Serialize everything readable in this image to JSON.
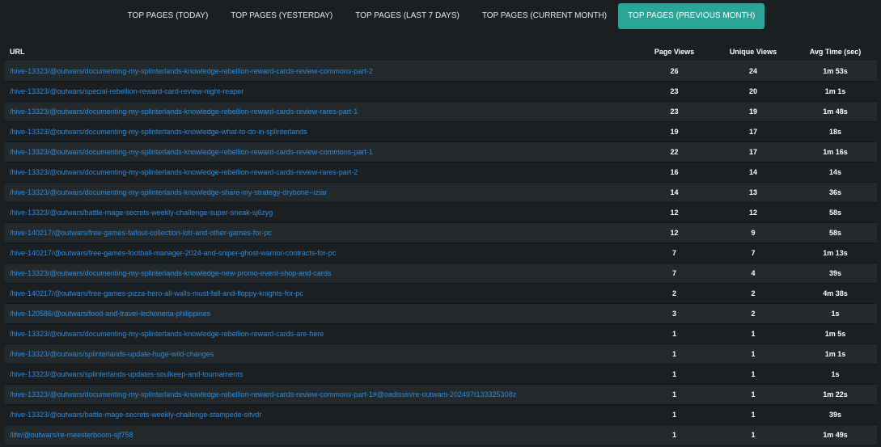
{
  "tabs": [
    {
      "label": "TOP PAGES (TODAY)",
      "active": false
    },
    {
      "label": "TOP PAGES (YESTERDAY)",
      "active": false
    },
    {
      "label": "TOP PAGES (LAST 7 DAYS)",
      "active": false
    },
    {
      "label": "TOP PAGES (CURRENT MONTH)",
      "active": false
    },
    {
      "label": "TOP PAGES (PREVIOUS MONTH)",
      "active": true
    }
  ],
  "table": {
    "headers": {
      "url": "URL",
      "page_views": "Page Views",
      "unique_views": "Unique Views",
      "avg_time": "Avg Time (sec)"
    },
    "rows": [
      {
        "url": "/hive-13323/@outwars/documenting-my-splinterlands-knowledge-rebellion-reward-cards-review-commons-part-2",
        "page_views": "26",
        "unique_views": "24",
        "avg_time": "1m 53s"
      },
      {
        "url": "/hive-13323/@outwars/special-rebellion-reward-card-review-night-reaper",
        "page_views": "23",
        "unique_views": "20",
        "avg_time": "1m 1s"
      },
      {
        "url": "/hive-13323/@outwars/documenting-my-splinterlands-knowledge-rebellion-reward-cards-review-rares-part-1",
        "page_views": "23",
        "unique_views": "19",
        "avg_time": "1m 48s"
      },
      {
        "url": "/hive-13323/@outwars/documenting-my-splinterlands-knowledge-what-to-do-in-splinterlands",
        "page_views": "19",
        "unique_views": "17",
        "avg_time": "18s"
      },
      {
        "url": "/hive-13323/@outwars/documenting-my-splinterlands-knowledge-rebellion-reward-cards-review-commons-part-1",
        "page_views": "22",
        "unique_views": "17",
        "avg_time": "1m 16s"
      },
      {
        "url": "/hive-13323/@outwars/documenting-my-splinterlands-knowledge-rebellion-reward-cards-review-rares-part-2",
        "page_views": "16",
        "unique_views": "14",
        "avg_time": "14s"
      },
      {
        "url": "/hive-13323/@outwars/documenting-my-splinterlands-knowledge-share-my-strategy-drybone--iziar",
        "page_views": "14",
        "unique_views": "13",
        "avg_time": "36s"
      },
      {
        "url": "/hive-13323/@outwars/battle-mage-secrets-weekly-challenge-super-sneak-sj6zyg",
        "page_views": "12",
        "unique_views": "12",
        "avg_time": "58s"
      },
      {
        "url": "/hive-140217/@outwars/free-games-fallout-collection-lotr-and-other-games-for-pc",
        "page_views": "12",
        "unique_views": "9",
        "avg_time": "58s"
      },
      {
        "url": "/hive-140217/@outwars/free-games-football-manager-2024-and-sniper-ghost-warrior-contracts-for-pc",
        "page_views": "7",
        "unique_views": "7",
        "avg_time": "1m 13s"
      },
      {
        "url": "/hive-13323/@outwars/documenting-my-splinterlands-knowledge-new-promo-event-shop-and-cards",
        "page_views": "7",
        "unique_views": "4",
        "avg_time": "39s"
      },
      {
        "url": "/hive-140217/@outwars/free-games-pizza-hero-all-walls-must-fall-and-floppy-knights-for-pc",
        "page_views": "2",
        "unique_views": "2",
        "avg_time": "4m 38s"
      },
      {
        "url": "/hive-120586/@outwars/food-and-travel-lechoneria-philippines",
        "page_views": "3",
        "unique_views": "2",
        "avg_time": "1s"
      },
      {
        "url": "/hive-13323/@outwars/documenting-my-splinterlands-knowledge-rebellion-reward-cards-are-here",
        "page_views": "1",
        "unique_views": "1",
        "avg_time": "1m 5s"
      },
      {
        "url": "/hive-13323/@outwars/splinterlands-update-huge-wild-changes",
        "page_views": "1",
        "unique_views": "1",
        "avg_time": "1m 1s"
      },
      {
        "url": "/hive-13323/@outwars/splinterlands-updates-soulkeep-and-tournaments",
        "page_views": "1",
        "unique_views": "1",
        "avg_time": "1s"
      },
      {
        "url": "/hive-13323/@outwars/documenting-my-splinterlands-knowledge-rebellion-reward-cards-review-commons-part-1#@oadissin/re-outwars-202497t133325308z",
        "page_views": "1",
        "unique_views": "1",
        "avg_time": "1m 22s"
      },
      {
        "url": "/hive-13323/@outwars/battle-mage-secrets-weekly-challenge-stampede-sitvdr",
        "page_views": "1",
        "unique_views": "1",
        "avg_time": "39s"
      },
      {
        "url": "/life/@outwars/re-meesterboom-sjf758",
        "page_views": "1",
        "unique_views": "1",
        "avg_time": "1m 49s"
      }
    ]
  },
  "colors": {
    "background": "#1c1f21",
    "row_alt": "#24292c",
    "accent": "#2aa597",
    "link": "#2e8ee0"
  }
}
